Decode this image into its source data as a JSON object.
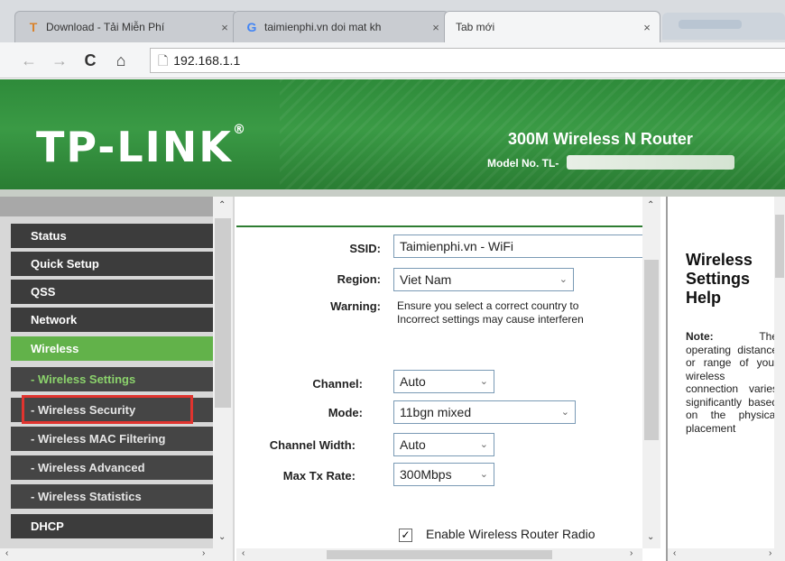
{
  "browser": {
    "tabs": [
      {
        "favicon": "T",
        "title": "Download - Tải Miễn Phí",
        "close": "×"
      },
      {
        "favicon": "G",
        "title": "taimienphi.vn doi mat kh",
        "close": "×"
      },
      {
        "favicon": "",
        "title": "Tab mới",
        "close": "×"
      }
    ],
    "nav": {
      "back": "←",
      "forward": "→",
      "reload": "C",
      "home": "⌂"
    },
    "url": "192.168.1.1",
    "page_icon": "🗋"
  },
  "banner": {
    "logo": "TP-LINK",
    "logo_mark": "®",
    "product": "300M Wireless N Router",
    "model_prefix": "Model No. TL-"
  },
  "menu": {
    "items": [
      {
        "label": "Status",
        "kind": "main"
      },
      {
        "label": "Quick Setup",
        "kind": "main"
      },
      {
        "label": "QSS",
        "kind": "main"
      },
      {
        "label": "Network",
        "kind": "main"
      },
      {
        "label": "Wireless",
        "kind": "active"
      },
      {
        "label": "- Wireless Settings",
        "kind": "subactive"
      },
      {
        "label": "- Wireless Security",
        "kind": "sub"
      },
      {
        "label": "- Wireless MAC Filtering",
        "kind": "sub"
      },
      {
        "label": "- Wireless Advanced",
        "kind": "sub"
      },
      {
        "label": "- Wireless Statistics",
        "kind": "sub"
      },
      {
        "label": "DHCP",
        "kind": "main"
      }
    ]
  },
  "form": {
    "ssid_label": "SSID:",
    "ssid_value": "Taimienphi.vn - WiFi",
    "region_label": "Region:",
    "region_value": "Viet Nam",
    "warning_label": "Warning:",
    "warning_line1": "Ensure you select a correct country to",
    "warning_line2": "Incorrect settings may cause interferen",
    "channel_label": "Channel:",
    "channel_value": "Auto",
    "mode_label": "Mode:",
    "mode_value": "11bgn mixed",
    "width_label": "Channel Width:",
    "width_value": "Auto",
    "rate_label": "Max Tx Rate:",
    "rate_value": "300Mbps",
    "radio_label": "Enable Wireless Router Radio",
    "radio_checked": "✓"
  },
  "help": {
    "title": "Wireless Settings Help",
    "note_label": "Note:",
    "note_text": "The operating distance or range of your wireless connection varies significantly based on the physical placement"
  },
  "colors": {
    "brand_green": "#2e8b3a",
    "menu_active": "#62b24a",
    "highlight_box": "#e0342f"
  },
  "icons": {
    "dropdown": "⌄",
    "scroll_up": "⌃",
    "scroll_down": "⌄",
    "scroll_left": "‹",
    "scroll_right": "›"
  }
}
